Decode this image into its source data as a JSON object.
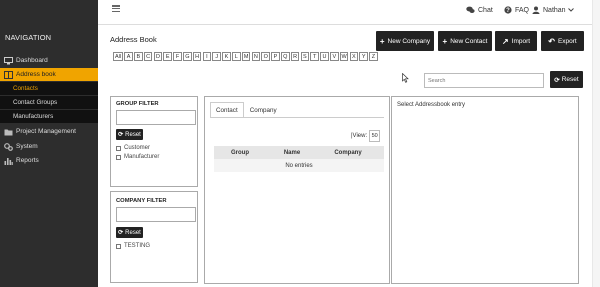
{
  "sidebar": {
    "title": "NAVIGATION",
    "items": [
      {
        "label": "Dashboard",
        "icon": "monitor-icon"
      },
      {
        "label": "Address book",
        "icon": "book-icon",
        "active": true
      },
      {
        "label": "Project Management",
        "icon": "folder-icon"
      },
      {
        "label": "System",
        "icon": "gears-icon"
      },
      {
        "label": "Reports",
        "icon": "bar-chart-icon"
      }
    ],
    "subitems": [
      {
        "label": "Contacts",
        "current": true
      },
      {
        "label": "Contact Groups"
      },
      {
        "label": "Manufacturers"
      }
    ]
  },
  "topbar": {
    "chat": "Chat",
    "faq": "FAQ",
    "user": "Nathan"
  },
  "page": {
    "title": "Address Book"
  },
  "actions": {
    "new_company": "New Company",
    "new_contact": "New Contact",
    "import": "Import",
    "export": "Export",
    "plus_glyph": "+",
    "import_glyph": "↗",
    "export_glyph": "↶"
  },
  "alphabet": [
    "All",
    "A",
    "B",
    "C",
    "D",
    "E",
    "F",
    "G",
    "H",
    "I",
    "J",
    "K",
    "L",
    "M",
    "N",
    "O",
    "P",
    "Q",
    "R",
    "S",
    "T",
    "U",
    "V",
    "W",
    "X",
    "Y",
    "Z"
  ],
  "search": {
    "placeholder": "Search"
  },
  "reset_label": "Reset",
  "reset_glyph": "⟳",
  "group_filter": {
    "title": "GROUP FILTER",
    "options": [
      "Customer",
      "Manufacturer"
    ]
  },
  "company_filter": {
    "title": "COMPANY FILTER",
    "options": [
      "TESTING"
    ]
  },
  "list": {
    "tabs": [
      "Contact",
      "Company"
    ],
    "view_label": "|View:",
    "view_value": "50",
    "columns": [
      "Group",
      "Name",
      "Company"
    ],
    "empty": "No entries"
  },
  "detail": {
    "title": "Select Addressbook entry"
  },
  "colors": {
    "accent": "#f0a400",
    "sidebar": "#2d2d2d",
    "button": "#222222"
  }
}
